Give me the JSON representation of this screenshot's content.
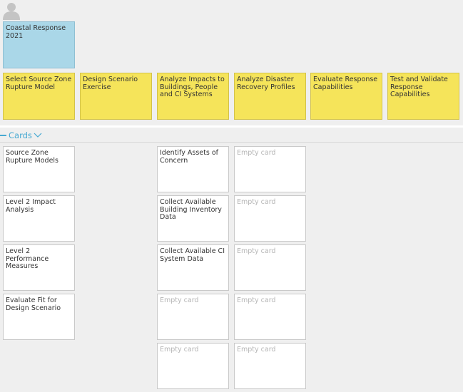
{
  "board": {
    "epic_card": {
      "text": "Coastal Response 2021"
    },
    "activities": [
      "Select Source Zone Rupture Model",
      "Design Scenario Exercise",
      "Analyze Impacts to Buildings, People and CI Systems",
      "Analyze Disaster Recovery Profiles",
      "Evaluate Response Capabilities",
      "Test and Validate Response Capabilities"
    ]
  },
  "section": {
    "title": "Cards"
  },
  "cards": {
    "column1": [
      "Source Zone Rupture Models",
      "Level 2 Impact Analysis",
      "Level 2 Performance Measures",
      "Evaluate Fit for Design Scenario"
    ],
    "column3": [
      "Identify Assets of Concern",
      "Collect Available Building Inventory Data",
      "Collect Available CI System Data",
      "Empty card",
      "Empty card"
    ],
    "column4": [
      "Empty card",
      "Empty card",
      "Empty card",
      "Empty card",
      "Empty card"
    ]
  },
  "colors": {
    "epic": "#aad7e8",
    "activity": "#f5e45a",
    "card": "#ffffff",
    "accent": "#47a9d2",
    "empty_text": "#b5b5b5"
  },
  "icons": {
    "avatar": "user-avatar-icon",
    "collapse": "chevron-down-icon"
  }
}
